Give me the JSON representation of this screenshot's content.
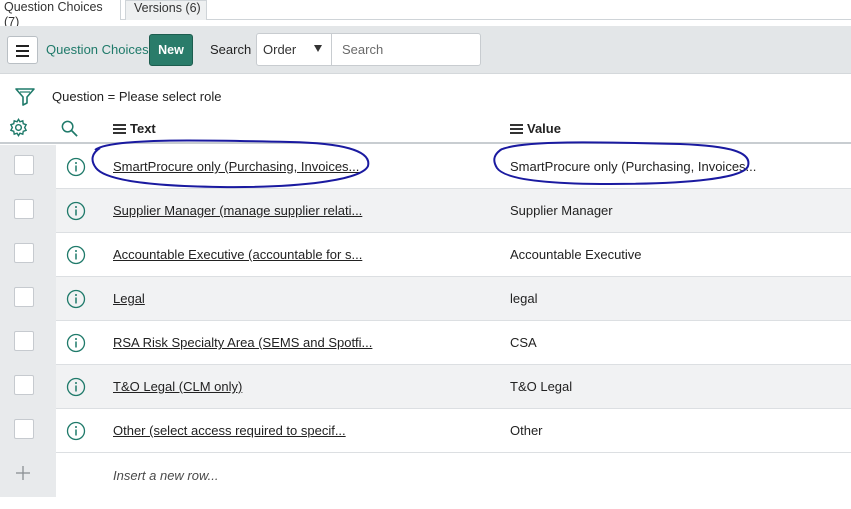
{
  "tabs": [
    {
      "label": "Question Choices (7)",
      "active": true
    },
    {
      "label": "Versions (6)",
      "active": false
    }
  ],
  "toolbar": {
    "menu_icon": "hamburger-icon",
    "title": "Question Choices",
    "new_label": "New",
    "search_label": "Search",
    "search_field_selected": "Order",
    "search_placeholder": "Search"
  },
  "filter": {
    "icon": "funnel-icon",
    "text": "Question = Please select role"
  },
  "table": {
    "columns": [
      {
        "label": "Text"
      },
      {
        "label": "Value"
      }
    ],
    "rows": [
      {
        "text": "SmartProcure only  (Purchasing, Invoices...",
        "value": "SmartProcure only  (Purchasing, Invoices..."
      },
      {
        "text": "Supplier Manager (manage supplier relati...",
        "value": "Supplier Manager"
      },
      {
        "text": "Accountable Executive (accountable for s...",
        "value": "Accountable Executive"
      },
      {
        "text": "Legal",
        "value": "legal"
      },
      {
        "text": "RSA Risk Specialty Area (SEMS and Spotfi...",
        "value": "CSA"
      },
      {
        "text": "T&O Legal (CLM only)",
        "value": "T&O Legal"
      },
      {
        "text": "Other  (select access required to specif...",
        "value": "Other"
      }
    ],
    "insert_row_label": "Insert a new row..."
  },
  "colors": {
    "accent": "#2a7c6a",
    "annotation": "#1a1aa0"
  }
}
